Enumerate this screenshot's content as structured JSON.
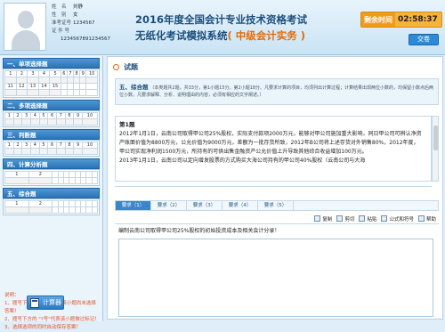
{
  "candidate": {
    "fields": [
      {
        "key": "姓　名",
        "value": "刘静"
      },
      {
        "key": "性　别",
        "value": "女"
      },
      {
        "key": "准考证号",
        "value": "1234567"
      },
      {
        "key": "证 件 号",
        "value": ""
      },
      {
        "key": "",
        "value": "1234567891234567"
      }
    ]
  },
  "header": {
    "title_line1": "2016年度全国会计专业技术资格考试",
    "title_line2": "无纸化考试模拟系统",
    "level": "( 中级会计实务 )",
    "timer_label": "剩余时间",
    "timer_value": "02:58:37",
    "submit_label": "交卷"
  },
  "sidebar": {
    "sections": [
      {
        "title": "一、单项选择题",
        "rows": [
          [
            "1",
            "2",
            "3",
            "4",
            "5",
            "6",
            "7",
            "8",
            "9",
            "10"
          ],
          [
            "11",
            "12",
            "13",
            "14",
            "15",
            "",
            "",
            "",
            "",
            ""
          ]
        ]
      },
      {
        "title": "二、多项选择题",
        "rows": [
          [
            "1",
            "2",
            "3",
            "4",
            "5",
            "6",
            "7",
            "8",
            "9",
            "10"
          ]
        ]
      },
      {
        "title": "三、判断题",
        "rows": [
          [
            "1",
            "2",
            "3",
            "4",
            "5",
            "6",
            "7",
            "8",
            "9",
            "10"
          ]
        ]
      },
      {
        "title": "四、计算分析题",
        "rows": [
          [
            "1",
            "2",
            "",
            "",
            "",
            "",
            "",
            "",
            "",
            ""
          ]
        ]
      },
      {
        "title": "五、综合题",
        "rows": [
          [
            "1",
            "2",
            "",
            "",
            "",
            "",
            "",
            "",
            "",
            ""
          ]
        ]
      }
    ],
    "notes": [
      "说明：",
      "1、题号下方的 \"#号\"代表该小题尚未选择答案！",
      "2、题号下方的 \"?号\"代表该小题做过标记！",
      "3、选择选项的同时自动保存答案！"
    ],
    "calc_label": "计算器"
  },
  "main": {
    "section_label": "试题",
    "qtype_name": "五、综合题",
    "qtype_desc": "（本类题共2题，共33分，第1小题15分，第2小题18分。凡要求计算的项目，均须列出计算过程；计算结果出现两位小数的，均保留小数点后两位小数。凡要求解释、分析、说明理由的内容，必须有相应的文字阐述。）",
    "question_no": "第1题",
    "paragraphs": [
      "2012年1月1日，云南公司取得甲公司25%股权，实际支付款项2000万元，能够对甲公司施加重大影响，同日甲公司可辨认净资产账面价值为8800万元，公允价值为9000万元，差额为一批存货所致，2012年B公司将上述存货对外销售80%，2012年度，甲公司实现净利润1500万元，所持有的可供出售金融资产公允价值上升导致其他综合收益增加100万元。",
      "2013年1月1日，云南公司以定向增发股票的方式购买大海公司持有的甲公司40%股权（云南公司与大海"
    ],
    "tabs": [
      "要求（1）",
      "要求（2）",
      "要求（3）",
      "要求（4）",
      "要求（5）"
    ],
    "toolbar": [
      "复制",
      "剪切",
      "粘贴",
      "公式和符号",
      "帮助"
    ],
    "subquestion": "编制云南公司取得甲公司25%股权的初始投资成本及相关会计分录！"
  }
}
